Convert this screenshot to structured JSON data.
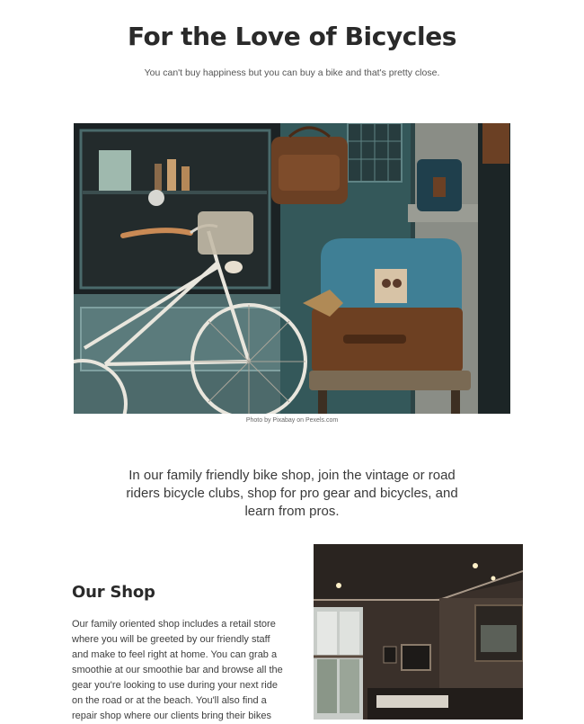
{
  "header": {
    "title": "For the Love of Bicycles",
    "tagline": "You can't buy happiness but you can buy a bike and that's pretty close."
  },
  "hero": {
    "caption": "Photo by Pixabay on Pexels.com"
  },
  "intro": {
    "text": "In our family friendly bike shop, join the vintage or road riders bicycle clubs, shop for pro gear and bicycles, and learn from pros."
  },
  "shop": {
    "heading": "Our Shop",
    "body": "Our family oriented shop includes a retail store where you will be greeted by our friendly staff and make to feel right at home. You can grab a smoothie at our smoothie bar and browse all the gear you're looking to use during your next ride on the road or at the beach. You'll also find a repair shop where our clients bring their bikes"
  },
  "colors": {
    "text": "#2b2b2b",
    "background": "#ffffff"
  }
}
